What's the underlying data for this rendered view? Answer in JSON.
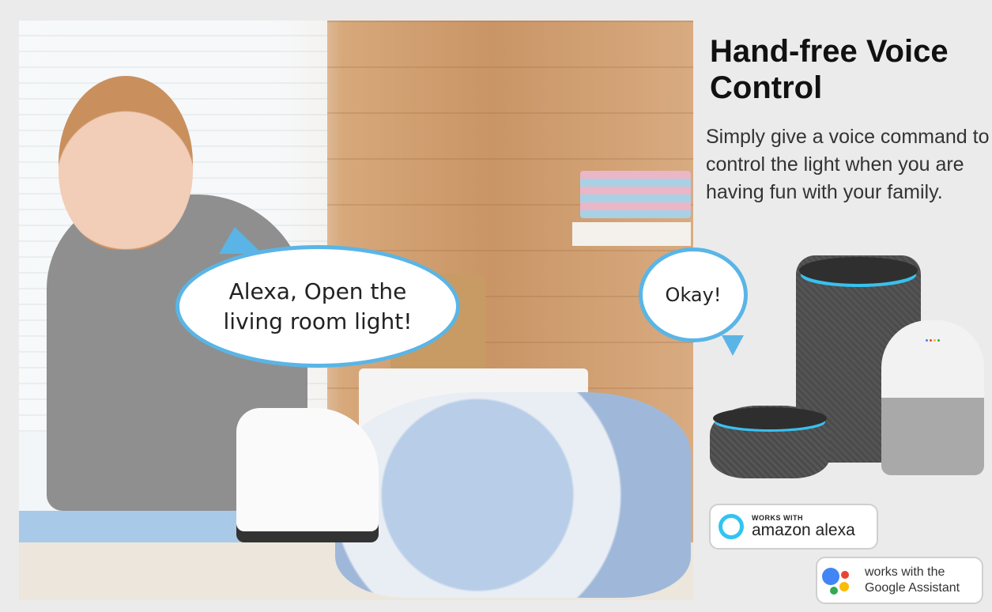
{
  "heading": {
    "title": "Hand-free Voice Control"
  },
  "description": "Simply give a voice command to control the light when you are having fun with your family.",
  "speech": {
    "user_line1": "Alexa, Open the",
    "user_line2": "living room light!",
    "assistant": "Okay!"
  },
  "badges": {
    "alexa_small": "WORKS WITH",
    "alexa_big": "amazon alexa",
    "google_line1": "works with the",
    "google_line2": "Google Assistant"
  },
  "colors": {
    "bubble_border": "#5ab5e6",
    "alexa_blue": "#31c4f3",
    "google_blue": "#4285f4",
    "google_red": "#ea4335",
    "google_yellow": "#fbbc05",
    "google_green": "#34a853"
  },
  "icons": [
    "alexa-logo-icon",
    "google-assistant-icon"
  ]
}
